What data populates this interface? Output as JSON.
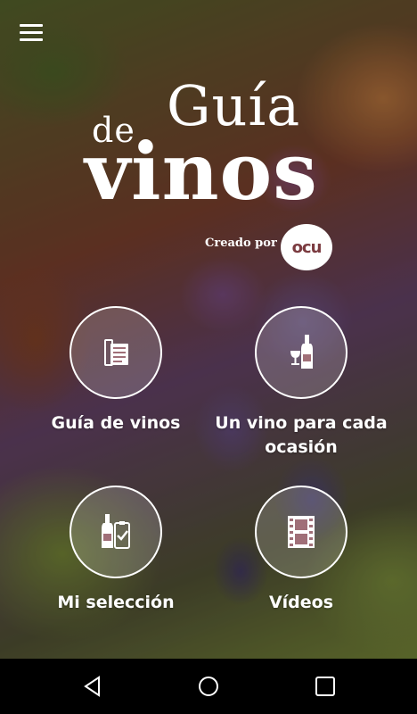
{
  "logo": {
    "de": "de",
    "guia": "Guía",
    "vinos": "vinos"
  },
  "credit": {
    "text": "Creado por",
    "brand": "ocu"
  },
  "menu": [
    {
      "label": "Guía de vinos",
      "icon": "book-list-icon"
    },
    {
      "label": "Un vino para cada ocasión",
      "icon": "bottle-glass-icon"
    },
    {
      "label": "Mi selección",
      "icon": "bottle-checklist-icon"
    },
    {
      "label": "Vídeos",
      "icon": "film-icon"
    }
  ],
  "navbar": {
    "back": "back-icon",
    "home": "home-icon",
    "recents": "recents-icon"
  },
  "colors": {
    "brand": "#7b3b40",
    "navbar": "#000000",
    "text": "#ffffff"
  }
}
